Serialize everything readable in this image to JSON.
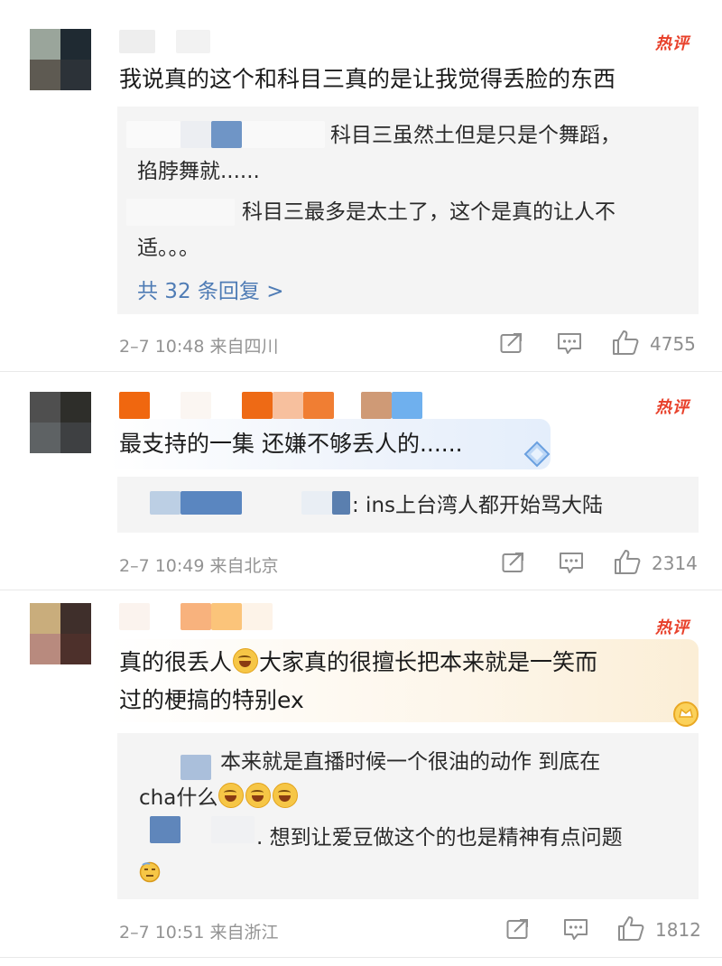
{
  "comments": [
    {
      "badge": "热评",
      "text": "我说真的这个和科目三真的是让我觉得丢脸的东西",
      "replies": [
        {
          "line1": "科目三虽然土但是只是个舞蹈，",
          "line2": "掐脖舞就......"
        },
        {
          "line1": "科目三最多是太土了，这个是真的让人不",
          "line2": "适。。。"
        }
      ],
      "more_replies": "共 32 条回复 >",
      "meta": "2–7 10:48  来自四川",
      "likes": "4755"
    },
    {
      "badge": "热评",
      "text": "最支持的一集 还嫌不够丢人的......",
      "replies": [
        {
          "line1": ": ins上台湾人都开始骂大陆"
        }
      ],
      "meta": "2–7 10:49  来自北京",
      "likes": "2314"
    },
    {
      "badge": "热评",
      "text_line1": "真的很丢人",
      "text_line1b": "大家真的很擅长把本来就是一笑而",
      "text_line2": "过的梗搞的特别ex",
      "replies": [
        {
          "line1": "本来就是直播时候一个很油的动作 到底在",
          "line2": "cha什么"
        },
        {
          "line1": ". 想到让爱豆做这个的也是精神有点问题"
        }
      ],
      "meta": "2–7 10:51  来自浙江",
      "likes": "1812"
    }
  ],
  "icons": {
    "share": "share-icon",
    "comment": "comment-icon",
    "like": "thumbs-up-icon"
  },
  "colors": {
    "hot_badge": "#e8402a",
    "link": "#4f7cb5",
    "meta": "#939393",
    "reply_bg": "#f4f4f4"
  }
}
